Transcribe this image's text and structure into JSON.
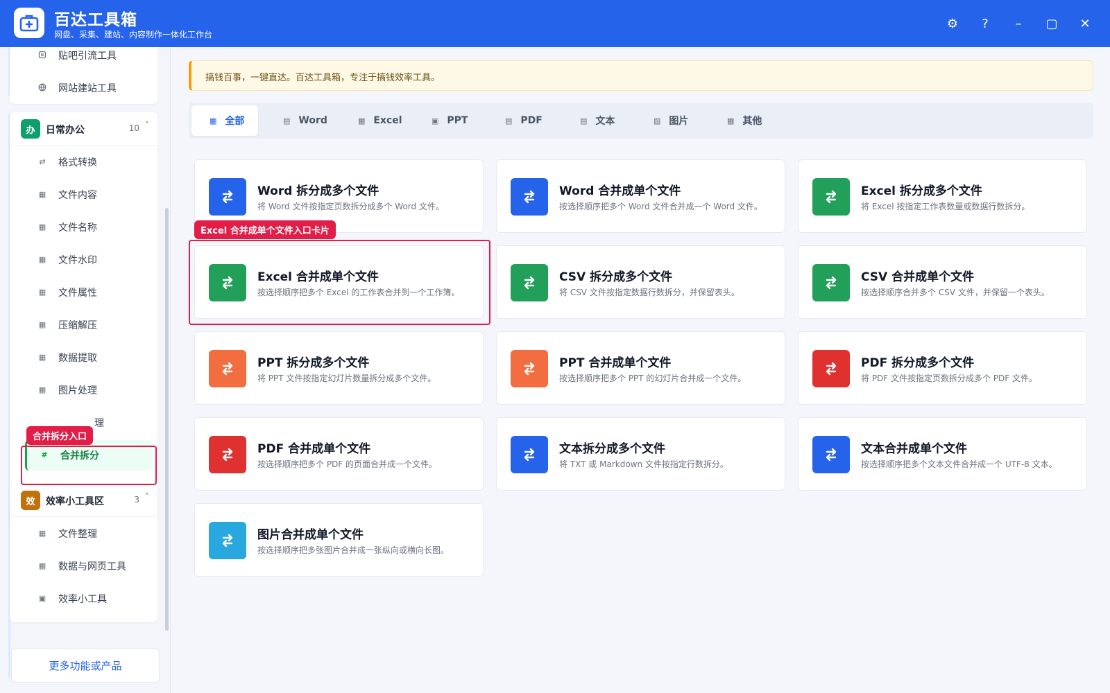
{
  "app": {
    "title": "百达工具箱",
    "subtitle": "网盘、采集、建站、内容制作一体化工作台"
  },
  "window_controls": {
    "settings_icon": "⚙",
    "help_icon": "?",
    "minimize_icon": "–",
    "maximize_icon": "▢",
    "close_icon": "✕"
  },
  "sidebar": {
    "top_group": {
      "items": [
        {
          "label": "贴吧引流工具",
          "icon": "doc-icon"
        },
        {
          "label": "网站建站工具",
          "icon": "globe-icon"
        }
      ]
    },
    "office_group": {
      "badge": "办",
      "title": "日常办公",
      "count": "10",
      "caret": "˄",
      "color": "#0f9f6e",
      "items": [
        {
          "label": "格式转换",
          "glyph": "⇄"
        },
        {
          "label": "文件内容",
          "glyph": "▦"
        },
        {
          "label": "文件名称",
          "glyph": "▦"
        },
        {
          "label": "文件水印",
          "glyph": "▦"
        },
        {
          "label": "文件属性",
          "glyph": "▦"
        },
        {
          "label": "压缩解压",
          "glyph": "▦"
        },
        {
          "label": "数据提取",
          "glyph": "▦"
        },
        {
          "label": "图片处理",
          "glyph": "▦"
        },
        {
          "label": "理",
          "glyph": ""
        },
        {
          "label": "合并拆分",
          "glyph": "#"
        }
      ]
    },
    "efficiency_group": {
      "badge": "效",
      "title": "效率小工具区",
      "count": "3",
      "caret": "˄",
      "color": "#c2700c",
      "items": [
        {
          "label": "文件整理",
          "glyph": "▦"
        },
        {
          "label": "数据与网页工具",
          "glyph": "▦"
        },
        {
          "label": "效率小工具",
          "glyph": "▣"
        }
      ]
    },
    "more_button": "更多功能或产品"
  },
  "annotations": {
    "sidebar_tag": "合并拆分入口",
    "card_tag": "Excel 合并成单个文件入口卡片"
  },
  "notice": {
    "text": "搞钱百事，一键直达。百达工具箱，专注于搞钱效率工具。"
  },
  "tabs": [
    {
      "label": "全部",
      "glyph": "▦"
    },
    {
      "label": "Word",
      "glyph": "▤"
    },
    {
      "label": "Excel",
      "glyph": "▦"
    },
    {
      "label": "PPT",
      "glyph": "▣"
    },
    {
      "label": "PDF",
      "glyph": "▤"
    },
    {
      "label": "文本",
      "glyph": "▤"
    },
    {
      "label": "图片",
      "glyph": "▨"
    },
    {
      "label": "其他",
      "glyph": "▦"
    }
  ],
  "colors": {
    "brand": "#2563eb",
    "word": "#2563eb",
    "excel": "#22a05a",
    "ppt": "#f26d40",
    "pdf": "#e03131",
    "text": "#2563eb",
    "image": "#29a8e0",
    "annotation": "#e11d48"
  },
  "cards": [
    {
      "title": "Word 拆分成多个文件",
      "desc": "将 Word 文件按指定页数拆分成多个 Word 文件。",
      "kind": "word"
    },
    {
      "title": "Word 合并成单个文件",
      "desc": "按选择顺序把多个 Word 文件合并成一个 Word 文件。",
      "kind": "word"
    },
    {
      "title": "Excel 拆分成多个文件",
      "desc": "将 Excel 按指定工作表数量或数据行数拆分。",
      "kind": "excel"
    },
    {
      "title": "Excel 合并成单个文件",
      "desc": "按选择顺序把多个 Excel 的工作表合并到一个工作簿。",
      "kind": "excel"
    },
    {
      "title": "CSV 拆分成多个文件",
      "desc": "将 CSV 文件按指定数据行数拆分，并保留表头。",
      "kind": "excel"
    },
    {
      "title": "CSV 合并成单个文件",
      "desc": "按选择顺序合并多个 CSV 文件，并保留一个表头。",
      "kind": "excel"
    },
    {
      "title": "PPT 拆分成多个文件",
      "desc": "将 PPT 文件按指定幻灯片数量拆分成多个文件。",
      "kind": "ppt"
    },
    {
      "title": "PPT 合并成单个文件",
      "desc": "按选择顺序把多个 PPT 的幻灯片合并成一个文件。",
      "kind": "ppt"
    },
    {
      "title": "PDF 拆分成多个文件",
      "desc": "将 PDF 文件按指定页数拆分成多个 PDF 文件。",
      "kind": "pdf"
    },
    {
      "title": "PDF 合并成单个文件",
      "desc": "按选择顺序把多个 PDF 的页面合并成一个文件。",
      "kind": "pdf"
    },
    {
      "title": "文本拆分成多个文件",
      "desc": "将 TXT 或 Markdown 文件按指定行数拆分。",
      "kind": "text"
    },
    {
      "title": "文本合并成单个文件",
      "desc": "按选择顺序把多个文本文件合并成一个 UTF-8 文本。",
      "kind": "text"
    },
    {
      "title": "图片合并成单个文件",
      "desc": "按选择顺序把多张图片合并成一张纵向或横向长图。",
      "kind": "image"
    }
  ]
}
